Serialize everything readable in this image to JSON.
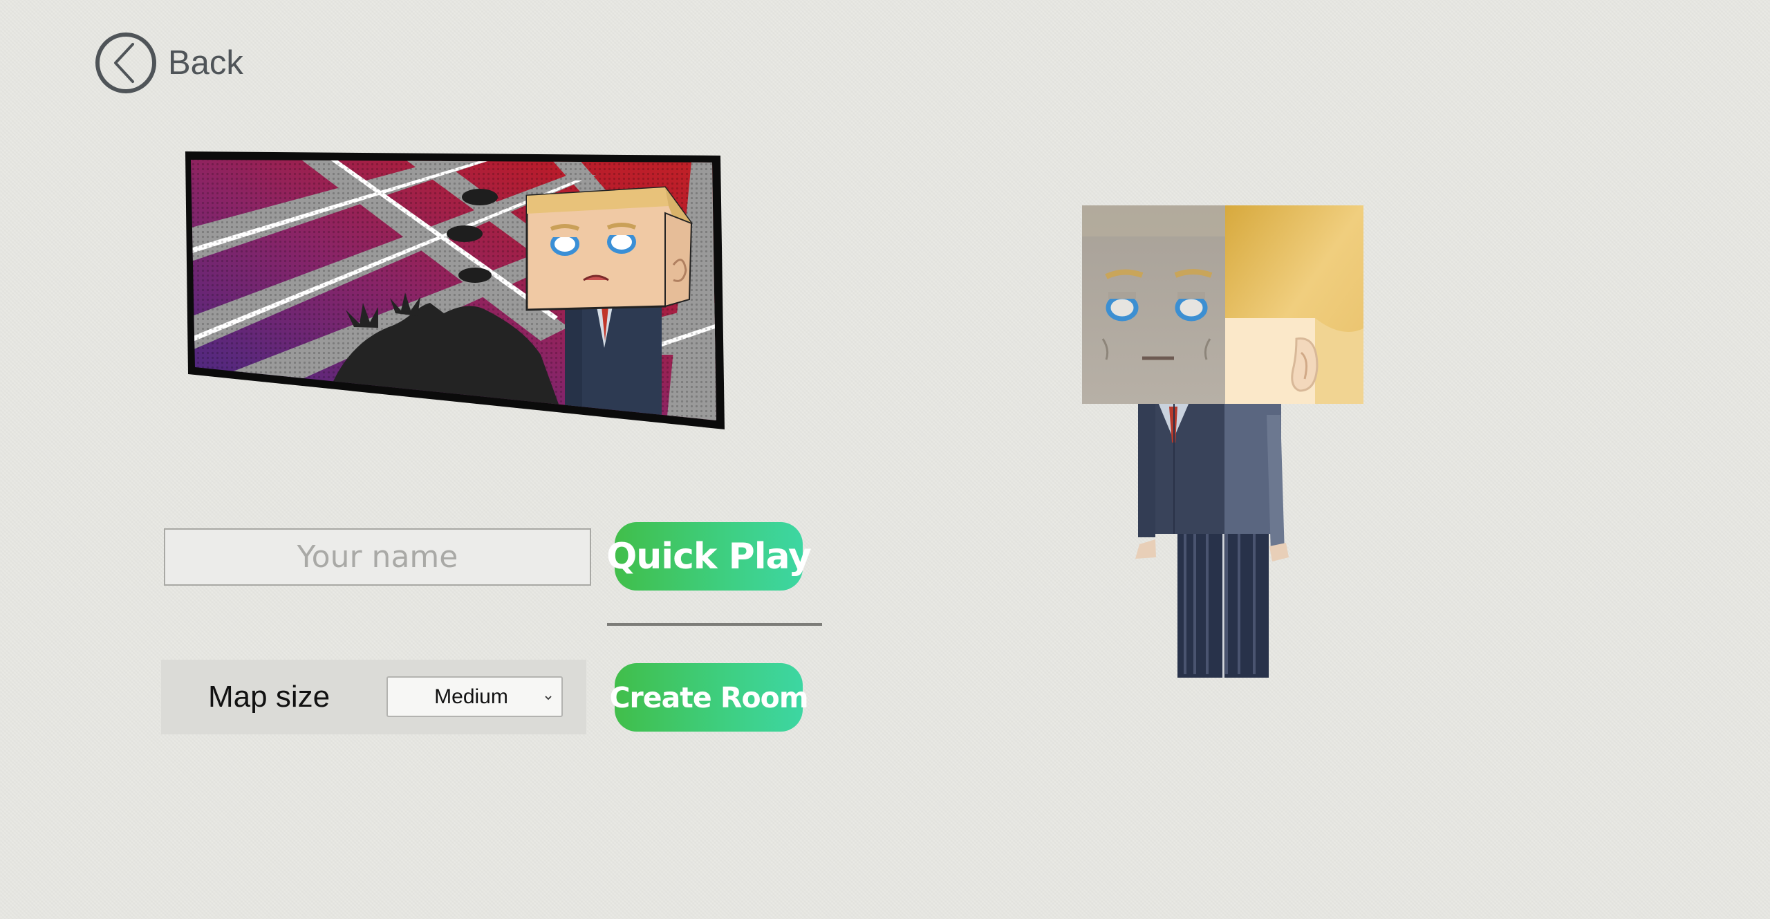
{
  "back": {
    "label": "Back",
    "icon": "chevron-left-circle-icon"
  },
  "name_input": {
    "placeholder": "Your name",
    "value": ""
  },
  "buttons": {
    "quick_play": "Quick Play",
    "create_room": "Create Room"
  },
  "map_size": {
    "label": "Map size",
    "selected": "Medium"
  },
  "colors": {
    "background": "#e9e9e4",
    "button_gradient_start": "#41be4a",
    "button_gradient_end": "#3dd6a2",
    "back_icon": "#4f5458"
  }
}
